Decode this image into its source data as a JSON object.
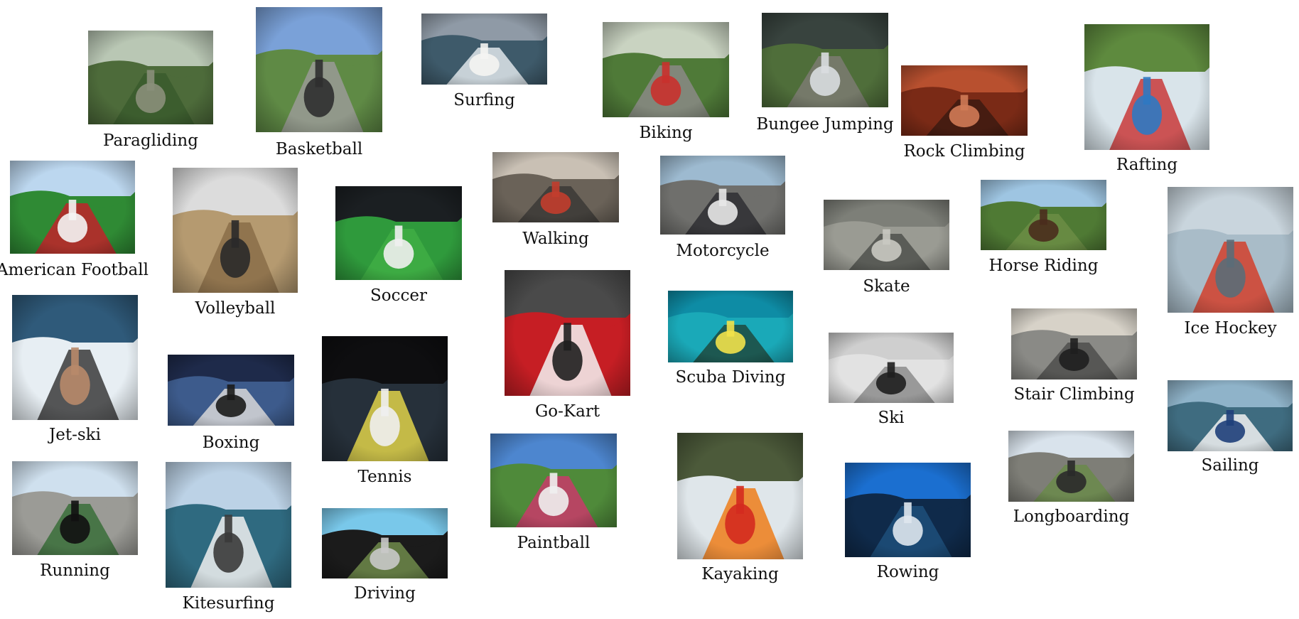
{
  "collage": {
    "activities": [
      {
        "id": "paragliding",
        "label": "Paragliding",
        "palette": [
          "#b9c7b4",
          "#4d6b3a",
          "#3a5a2d",
          "#8a8f7a"
        ]
      },
      {
        "id": "basketball",
        "label": "Basketball",
        "palette": [
          "#7aa1d8",
          "#5f8a45",
          "#9a9a96",
          "#2f2f2f"
        ]
      },
      {
        "id": "surfing",
        "label": "Surfing",
        "palette": [
          "#8f9aa6",
          "#3e5a6a",
          "#dfe6ea",
          "#f4f4f2"
        ]
      },
      {
        "id": "biking",
        "label": "Biking",
        "palette": [
          "#c9d3c1",
          "#4f7a38",
          "#8a8a86",
          "#c9312c"
        ]
      },
      {
        "id": "bungee-jumping",
        "label": "Bungee Jumping",
        "palette": [
          "#38433e",
          "#4f6e3a",
          "#7b7b72",
          "#d9dde0"
        ]
      },
      {
        "id": "rock-climbing",
        "label": "Rock Climbing",
        "palette": [
          "#b8502f",
          "#7a2a16",
          "#3d1a10",
          "#d07b56"
        ]
      },
      {
        "id": "rafting",
        "label": "Rafting",
        "palette": [
          "#5e8a3e",
          "#d9e4ea",
          "#c83a3a",
          "#2f79c2"
        ]
      },
      {
        "id": "american-football",
        "label": "American Football",
        "palette": [
          "#bcd7ef",
          "#2f8a34",
          "#c0222a",
          "#f4f4f4"
        ]
      },
      {
        "id": "volleyball",
        "label": "Volleyball",
        "palette": [
          "#dcdcdc",
          "#b59a70",
          "#8a6d48",
          "#2a2a2a"
        ]
      },
      {
        "id": "soccer",
        "label": "Soccer",
        "palette": [
          "#1b1f22",
          "#2f9a3c",
          "#3fae44",
          "#f0f0f0"
        ]
      },
      {
        "id": "walking",
        "label": "Walking",
        "palette": [
          "#c9c0b4",
          "#6a6258",
          "#3b3a36",
          "#c23d2e"
        ]
      },
      {
        "id": "motorcycle",
        "label": "Motorcycle",
        "palette": [
          "#9dbad0",
          "#6f6f6c",
          "#2f2f33",
          "#e8e8e8"
        ]
      },
      {
        "id": "skate",
        "label": "Skate",
        "palette": [
          "#7d7f78",
          "#9a9b93",
          "#4f514c",
          "#c9c9c2"
        ]
      },
      {
        "id": "horse-riding",
        "label": "Horse Riding",
        "palette": [
          "#9ec5e2",
          "#4f7a34",
          "#6b8d45",
          "#4a2c1d"
        ]
      },
      {
        "id": "ice-hockey",
        "label": "Ice Hockey",
        "palette": [
          "#c9d5dd",
          "#a9bcc8",
          "#d2402b",
          "#5b6d78"
        ]
      },
      {
        "id": "jet-ski",
        "label": "Jet-ski",
        "palette": [
          "#2f5a7a",
          "#e7eef3",
          "#3a3a3a",
          "#b88a6a"
        ]
      },
      {
        "id": "boxing",
        "label": "Boxing",
        "palette": [
          "#1e2a4a",
          "#3d5b8c",
          "#d8d8d8",
          "#1b1b1b"
        ]
      },
      {
        "id": "tennis",
        "label": "Tennis",
        "palette": [
          "#0e0e10",
          "#26303a",
          "#e0d24a",
          "#f0f0f0"
        ]
      },
      {
        "id": "go-kart",
        "label": "Go-Kart",
        "palette": [
          "#4a4a4a",
          "#c61e24",
          "#f3f3f3",
          "#1f1f1f"
        ]
      },
      {
        "id": "scuba-diving",
        "label": "Scuba Diving",
        "palette": [
          "#0e8ca5",
          "#1aa9b8",
          "#1f4a3e",
          "#f2e24a"
        ]
      },
      {
        "id": "ski",
        "label": "Ski",
        "palette": [
          "#cfcfcf",
          "#e2e2e2",
          "#8c8c8c",
          "#1f1f1f"
        ]
      },
      {
        "id": "stair-climbing",
        "label": "Stair Climbing",
        "palette": [
          "#d7d2c8",
          "#8a8a86",
          "#4e4e4c",
          "#1f1f1f"
        ]
      },
      {
        "id": "sailing",
        "label": "Sailing",
        "palette": [
          "#8fb3c9",
          "#3f6c80",
          "#f1f1f1",
          "#1f3f7a"
        ]
      },
      {
        "id": "running",
        "label": "Running",
        "palette": [
          "#cfe0ee",
          "#9b9b96",
          "#3a6e3a",
          "#111111"
        ]
      },
      {
        "id": "kitesurfing",
        "label": "Kitesurfing",
        "palette": [
          "#bcd2e6",
          "#2f6a80",
          "#f0f0f0",
          "#3a3a3a"
        ]
      },
      {
        "id": "driving",
        "label": "Driving",
        "palette": [
          "#79c8ea",
          "#1b1b1b",
          "#6e8a4a",
          "#c9c9c9"
        ]
      },
      {
        "id": "paintball",
        "label": "Paintball",
        "palette": [
          "#4d86cf",
          "#4f8a3a",
          "#c83a6a",
          "#f0f0f0"
        ]
      },
      {
        "id": "kayaking",
        "label": "Kayaking",
        "palette": [
          "#4c5a3a",
          "#dfe6ea",
          "#ef7d1a",
          "#d42a1f"
        ]
      },
      {
        "id": "rowing",
        "label": "Rowing",
        "palette": [
          "#1b6fd0",
          "#0f2a4a",
          "#1d4f7a",
          "#dfe7ee"
        ]
      },
      {
        "id": "longboarding",
        "label": "Longboarding",
        "palette": [
          "#d9e3ec",
          "#7e7e77",
          "#6a8a4a",
          "#2a2a2a"
        ]
      }
    ]
  }
}
